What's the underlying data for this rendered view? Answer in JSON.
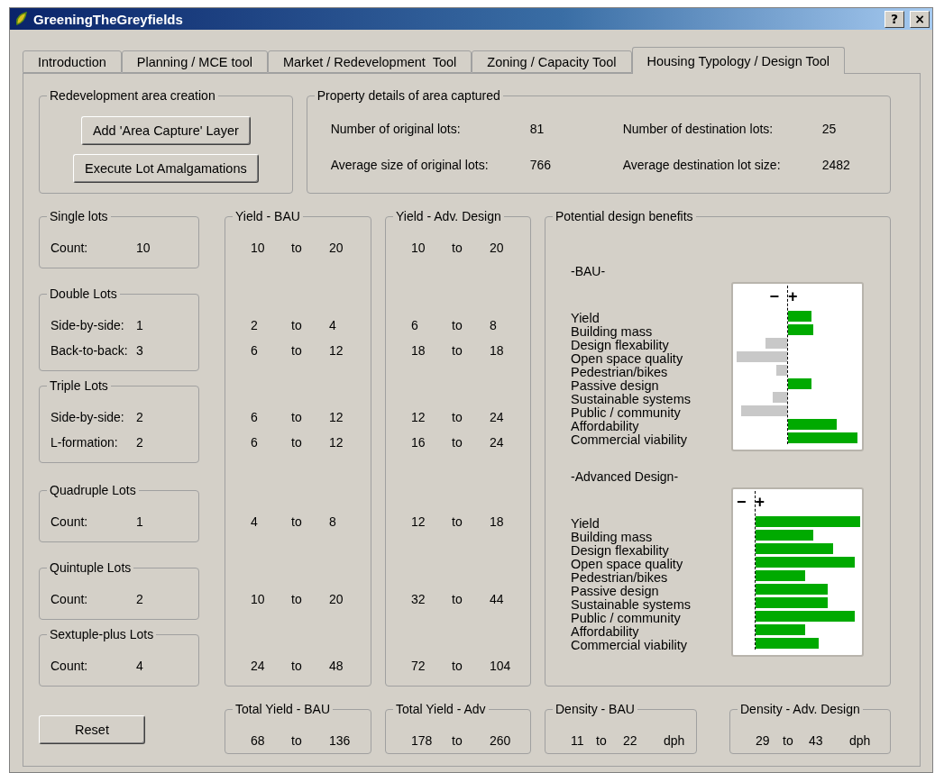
{
  "window": {
    "title": "GreeningTheGreyfields",
    "help_button": "?",
    "close_button": "×"
  },
  "tabs": [
    {
      "label": "Introduction",
      "selected": false
    },
    {
      "label": "Planning / MCE tool",
      "selected": false
    },
    {
      "label": "Market / Redevelopment  Tool",
      "selected": false
    },
    {
      "label": "Zoning / Capacity Tool",
      "selected": false
    },
    {
      "label": "Housing Typology / Design Tool",
      "selected": true
    }
  ],
  "area_creation": {
    "title": "Redevelopment area creation",
    "buttons": [
      "Add 'Area Capture' Layer",
      "Execute Lot Amalgamations"
    ]
  },
  "property_details": {
    "title": "Property details of area captured",
    "fields": [
      {
        "label": "Number of original lots:",
        "value": "81"
      },
      {
        "label": "Number of destination lots:",
        "value": "25"
      },
      {
        "label": "Average size of original lots:",
        "value": "766"
      },
      {
        "label": "Average destination lot size:",
        "value": "2482"
      }
    ]
  },
  "yield_bau_title": "Yield - BAU",
  "yield_adv_title": "Yield - Adv. Design",
  "lot_groups": [
    {
      "title": "Single lots",
      "rows": [
        {
          "label": "Count:",
          "count": "10",
          "bau": {
            "from": "10",
            "sep": "to",
            "to": "20"
          },
          "adv": {
            "from": "10",
            "sep": "to",
            "to": "20"
          }
        }
      ]
    },
    {
      "title": "Double Lots",
      "rows": [
        {
          "label": "Side-by-side:",
          "count": "1",
          "bau": {
            "from": "2",
            "sep": "to",
            "to": "4"
          },
          "adv": {
            "from": "6",
            "sep": "to",
            "to": "8"
          }
        },
        {
          "label": "Back-to-back:",
          "count": "3",
          "bau": {
            "from": "6",
            "sep": "to",
            "to": "12"
          },
          "adv": {
            "from": "18",
            "sep": "to",
            "to": "18"
          }
        }
      ]
    },
    {
      "title": "Triple Lots",
      "rows": [
        {
          "label": "Side-by-side:",
          "count": "2",
          "bau": {
            "from": "6",
            "sep": "to",
            "to": "12"
          },
          "adv": {
            "from": "12",
            "sep": "to",
            "to": "24"
          }
        },
        {
          "label": "L-formation:",
          "count": "2",
          "bau": {
            "from": "6",
            "sep": "to",
            "to": "12"
          },
          "adv": {
            "from": "16",
            "sep": "to",
            "to": "24"
          }
        }
      ]
    },
    {
      "title": "Quadruple Lots",
      "rows": [
        {
          "label": "Count:",
          "count": "1",
          "bau": {
            "from": "4",
            "sep": "to",
            "to": "8"
          },
          "adv": {
            "from": "12",
            "sep": "to",
            "to": "18"
          }
        }
      ]
    },
    {
      "title": "Quintuple Lots",
      "rows": [
        {
          "label": "Count:",
          "count": "2",
          "bau": {
            "from": "10",
            "sep": "to",
            "to": "20"
          },
          "adv": {
            "from": "32",
            "sep": "to",
            "to": "44"
          }
        }
      ]
    },
    {
      "title": "Sextuple-plus Lots",
      "rows": [
        {
          "label": "Count:",
          "count": "4",
          "bau": {
            "from": "24",
            "sep": "to",
            "to": "48"
          },
          "adv": {
            "from": "72",
            "sep": "to",
            "to": "104"
          }
        }
      ]
    }
  ],
  "benefits": {
    "title": "Potential design benefits",
    "charts": [
      {
        "title": "-BAU-",
        "minus_sign": "−",
        "plus_sign": "+",
        "items": [
          {
            "label": "Yield",
            "kind": "positive"
          },
          {
            "label": "Building mass",
            "kind": "positive"
          },
          {
            "label": "Design flexability",
            "kind": "negative"
          },
          {
            "label": "Open space quality",
            "kind": "negative"
          },
          {
            "label": "Pedestrian/bikes",
            "kind": "negative"
          },
          {
            "label": "Passive design",
            "kind": "positive"
          },
          {
            "label": "Sustainable systems",
            "kind": "negative"
          },
          {
            "label": "Public / community",
            "kind": "negative"
          },
          {
            "label": "Affordability",
            "kind": "positive"
          },
          {
            "label": "Commercial viability",
            "kind": "positive"
          }
        ]
      },
      {
        "title": "-Advanced Design-",
        "minus_sign": "−",
        "plus_sign": "+",
        "items": [
          {
            "label": "Yield",
            "kind": "positive"
          },
          {
            "label": "Building mass",
            "kind": "positive"
          },
          {
            "label": "Design flexability",
            "kind": "positive"
          },
          {
            "label": "Open space quality",
            "kind": "positive"
          },
          {
            "label": "Pedestrian/bikes",
            "kind": "positive"
          },
          {
            "label": "Passive design",
            "kind": "positive"
          },
          {
            "label": "Sustainable systems",
            "kind": "positive"
          },
          {
            "label": "Public / community",
            "kind": "positive"
          },
          {
            "label": "Affordability",
            "kind": "positive"
          },
          {
            "label": "Commercial viability",
            "kind": "positive"
          }
        ]
      }
    ]
  },
  "reset_button": "Reset",
  "totals": [
    {
      "title": "Total Yield - BAU",
      "from": "68",
      "sep": "to",
      "to": "136"
    },
    {
      "title": "Total Yield - Adv",
      "from": "178",
      "sep": "to",
      "to": "260"
    }
  ],
  "densities": [
    {
      "title": "Density - BAU",
      "from": "11",
      "sep": "to",
      "to": "22",
      "unit": "dph"
    },
    {
      "title": "Density - Adv. Design",
      "from": "29",
      "sep": "to",
      "to": "43",
      "unit": "dph"
    }
  ]
}
